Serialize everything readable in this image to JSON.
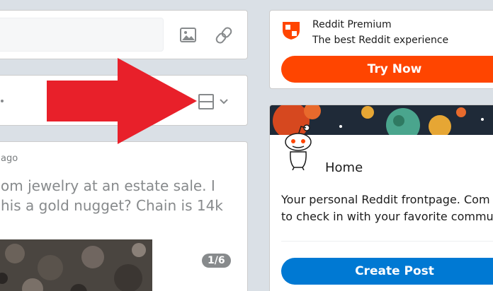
{
  "feed": {
    "post": {
      "meta_fragment": "ago",
      "title_line1": "om jewelry at an estate sale. I",
      "title_line2": "his a gold nugget? Chain is 14k",
      "gallery_counter": "1/6"
    }
  },
  "sidebar": {
    "premium": {
      "title": "Reddit Premium",
      "subtitle": "The best Reddit experience",
      "button_label": "Try Now"
    },
    "home": {
      "title": "Home",
      "description_line1": "Your personal Reddit frontpage. Com",
      "description_line2": "to check in with your favorite commu",
      "button_label": "Create Post"
    }
  },
  "icons": {
    "image": "image-icon",
    "link": "link-icon",
    "layout": "card-layout-icon",
    "chevron": "chevron-down-icon",
    "premium": "premium-shield-icon",
    "arrow": "red-arrow-annotation"
  },
  "colors": {
    "background": "#dae0e6",
    "premium_button": "#ff4500",
    "create_post_button": "#0079d3",
    "annotation_arrow": "#e8202a",
    "badge": "#878a8c"
  }
}
